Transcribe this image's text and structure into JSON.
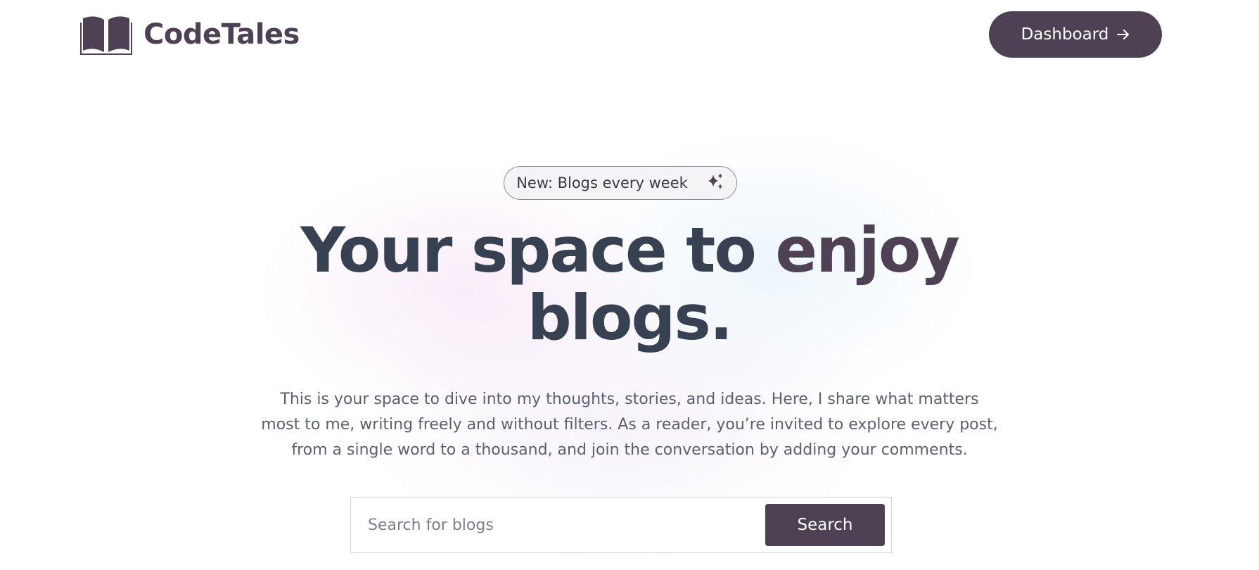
{
  "header": {
    "logo_text": "CodeTales",
    "logo_icon": "open-book-icon",
    "dashboard_label": "Dashboard",
    "dashboard_icon": "arrow-right-icon"
  },
  "hero": {
    "badge_text": "New: Blogs every week",
    "badge_icon": "sparkles-icon",
    "headline_part1": "Your space to ",
    "headline_accent": "enjoy",
    "headline_line2": "blogs.",
    "description": "This is your space to dive into my thoughts, stories, and ideas. Here, I share what matters most to me, writing freely and without filters. As a reader, you’re invited to explore every post, from a single word to a thousand, and join the conversation by adding your comments."
  },
  "search": {
    "placeholder": "Search for blogs",
    "value": "",
    "button_label": "Search"
  },
  "colors": {
    "brand": "#4e4153",
    "headline": "#374151",
    "text_muted": "#5b6070",
    "background": "#ffffff"
  }
}
